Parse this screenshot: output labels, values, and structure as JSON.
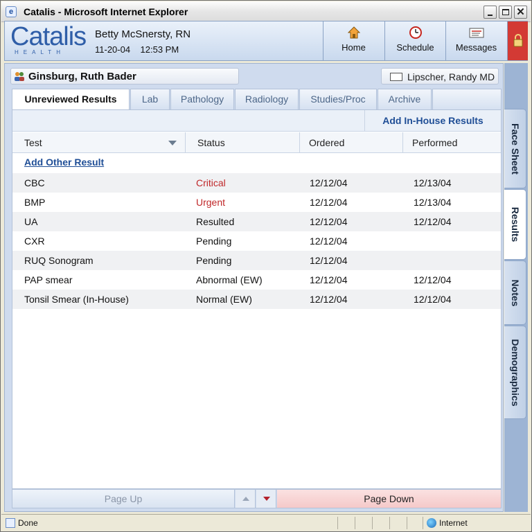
{
  "window": {
    "title": "Catalis - Microsoft Internet Explorer"
  },
  "header": {
    "logo_main": "Catalis",
    "logo_sub": "HEALTH",
    "user_name": "Betty McSnersty, RN",
    "date_time": "11-20-04    12:53 PM",
    "nav": [
      {
        "label": "Home",
        "icon": "home-icon"
      },
      {
        "label": "Schedule",
        "icon": "clock-icon"
      },
      {
        "label": "Messages",
        "icon": "messages-icon"
      }
    ],
    "lock_icon": "lock-icon"
  },
  "patient": {
    "name": "Ginsburg, Ruth Bader",
    "icon": "people-icon"
  },
  "provider": {
    "name": "Lipscher, Randy MD",
    "icon": "id-card-icon"
  },
  "tabs": [
    {
      "label": "Unreviewed Results",
      "active": true
    },
    {
      "label": "Lab"
    },
    {
      "label": "Pathology"
    },
    {
      "label": "Radiology"
    },
    {
      "label": "Studies/Proc"
    },
    {
      "label": "Archive"
    }
  ],
  "actions": {
    "add_in_house": "Add In-House Results",
    "add_other": "Add Other Result"
  },
  "table": {
    "columns": [
      "Test",
      "Status",
      "Ordered",
      "Performed"
    ],
    "rows": [
      {
        "test": "CBC",
        "status": "Critical",
        "ordered": "12/12/04",
        "performed": "12/13/04"
      },
      {
        "test": "BMP",
        "status": "Urgent",
        "ordered": "12/12/04",
        "performed": "12/13/04"
      },
      {
        "test": "UA",
        "status": "Resulted",
        "ordered": "12/12/04",
        "performed": "12/12/04"
      },
      {
        "test": "CXR",
        "status": "Pending",
        "ordered": "12/12/04",
        "performed": ""
      },
      {
        "test": "RUQ Sonogram",
        "status": "Pending",
        "ordered": "12/12/04",
        "performed": ""
      },
      {
        "test": "PAP smear",
        "status": "Abnormal (EW)",
        "ordered": "12/12/04",
        "performed": "12/12/04"
      },
      {
        "test": "Tonsil Smear (In-House)",
        "status": "Normal (EW)",
        "ordered": "12/12/04",
        "performed": "12/12/04"
      }
    ]
  },
  "paging": {
    "page_up": "Page Up",
    "page_down": "Page Down"
  },
  "side_tabs": [
    {
      "label": "Face Sheet"
    },
    {
      "label": "Results",
      "active": true
    },
    {
      "label": "Notes"
    },
    {
      "label": "Demographics"
    }
  ],
  "statusbar": {
    "status": "Done",
    "zone": "Internet"
  },
  "colors": {
    "accent": "#1f4e96",
    "critical": "#c0282a",
    "lock": "#d33a34",
    "page_down_bg": "#f5c9c9"
  }
}
